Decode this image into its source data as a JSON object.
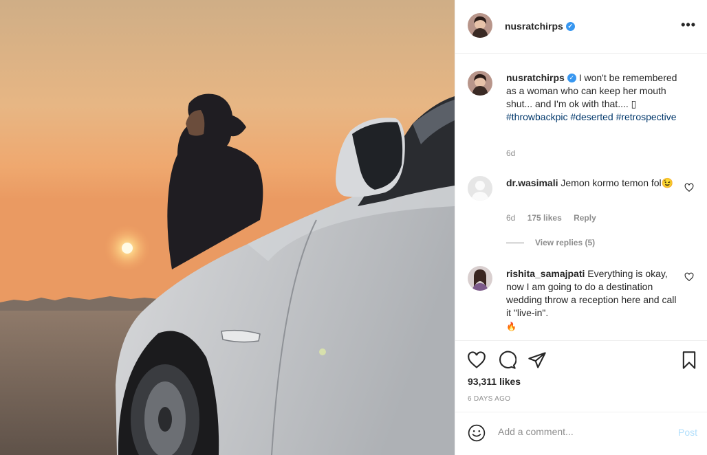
{
  "post": {
    "username": "nusratchirps",
    "verified_badge": "✓",
    "more_icon": "•••",
    "caption": {
      "username": "nusratchirps",
      "text": "I won't be remembered as a woman who can keep her mouth shut... and I'm ok with that.... ",
      "glyph": "▯",
      "hashtags": [
        "#throwbackpic",
        "#deserted",
        "#retrospective"
      ],
      "age": "6d"
    },
    "comments": [
      {
        "username": "dr.wasimali",
        "text": "Jemon kormo temon fol😉",
        "age": "6d",
        "likes": "175 likes",
        "reply_label": "Reply",
        "view_replies": "View replies (5)"
      },
      {
        "username": "rishita_samajpati",
        "text": "Everything is okay, now I am going to do a destination wedding throw a reception here and call it \"live-in\".",
        "emoji": "🔥"
      }
    ],
    "likes": "93,311 likes",
    "date": "6 DAYS AGO",
    "add_comment_placeholder": "Add a comment...",
    "post_label": "Post"
  },
  "colors": {
    "hashtag": "#00376b",
    "muted": "#8e8e8e",
    "post_button_disabled": "#b2dffc",
    "verified": "#3897f0"
  },
  "icons": [
    "more-options-icon",
    "heart-icon",
    "comment-icon",
    "share-icon",
    "bookmark-icon",
    "emoji-icon",
    "verified-icon"
  ]
}
